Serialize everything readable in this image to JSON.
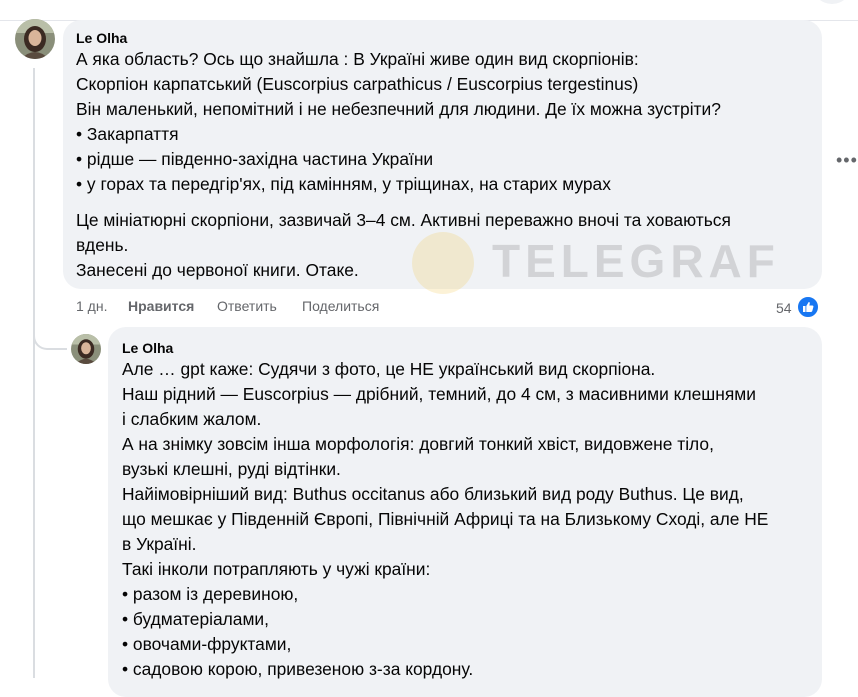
{
  "comment1": {
    "author": "Le Olha",
    "lines": [
      "А яка область? Ось що знайшла : В Україні живе один вид скорпіонів:",
      "Скорпіон карпатський (Euscorpius carpathicus / Euscorpius tergestinus)",
      "Він маленький, непомітний і не небезпечний для людини. Де їх можна зустріти?",
      "• Закарпаття",
      "• рідше — південно-західна частина України",
      "• у горах та передгір'ях, під камінням, у тріщинах, на старих мурах",
      "Це мініатюрні скорпіони, зазвичай 3–4 см. Активні переважно вночі та ховаються",
      "вдень.",
      "Занесені до червоної книги. Отаке."
    ],
    "time": "1 дн.",
    "like_label": "Нравится",
    "reply_label": "Ответить",
    "share_label": "Поделиться",
    "reaction_count": "54"
  },
  "comment2": {
    "author": "Le Olha",
    "lines": [
      "Але … gpt каже: Судячи з фото, це НЕ український вид скорпіона.",
      "Наш рідний — Euscorpius — дрібний, темний, до 4 см, з масивними клешнями",
      "і слабким жалом.",
      "А на знімку зовсім інша морфологія: довгий тонкий хвіст, видовжене тіло,",
      "вузькі клешні, руді відтінки.",
      "Найімовірніший вид: Buthus occitanus або близький вид роду Buthus. Це вид,",
      "що мешкає у Південній Європі, Північній Африці та на Близькому Сході, але НЕ",
      "в Україні.",
      "Такі інколи потрапляють у чужі країни:",
      "• разом із деревиною,",
      "• будматеріалами,",
      "• овочами-фруктами,",
      "• садовою корою, привезеною з-за кордону."
    ]
  },
  "watermark": {
    "text": "TELEGRAF"
  },
  "icons": {
    "like": "thumbs-up-icon",
    "more": "more-options-icon"
  },
  "colors": {
    "bubble": "#f0f2f5",
    "secondary_text": "#65676b",
    "like_blue": "#1877f2"
  }
}
